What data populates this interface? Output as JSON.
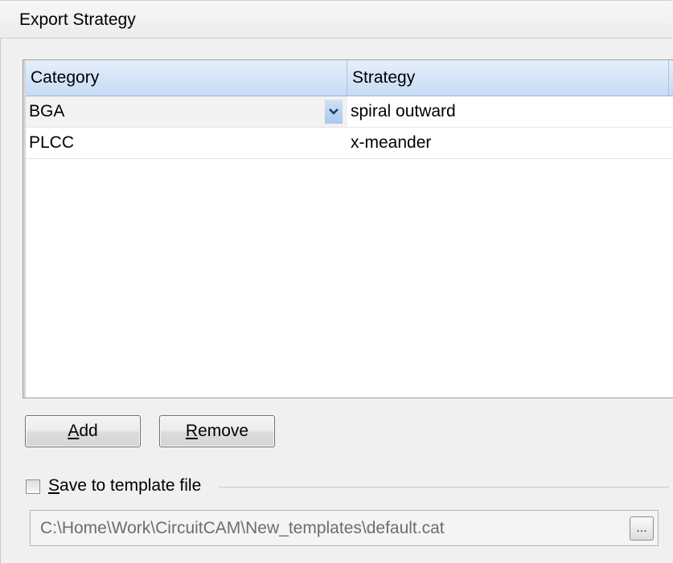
{
  "panel": {
    "title": "Export Strategy"
  },
  "grid": {
    "columns": [
      "Category",
      "Strategy"
    ],
    "rows": [
      {
        "category": "BGA",
        "strategy": "spiral outward"
      },
      {
        "category": "PLCC",
        "strategy": "x-meander"
      }
    ]
  },
  "buttons": {
    "add_mnemonic": "A",
    "add_rest": "dd",
    "remove_mnemonic": "R",
    "remove_rest": "emove"
  },
  "template": {
    "checked": false,
    "label_mnemonic": "S",
    "label_rest": "ave to template file",
    "path": "C:\\Home\\Work\\CircuitCAM\\New_templates\\default.cat",
    "browse_label": "..."
  },
  "colors": {
    "header_blue": "#d3e4f7",
    "dropdown_blue": "#a9c9ec",
    "dropdown_orange": "#f8cc86"
  },
  "icons": {
    "dropdown": "chevron-down-icon"
  }
}
